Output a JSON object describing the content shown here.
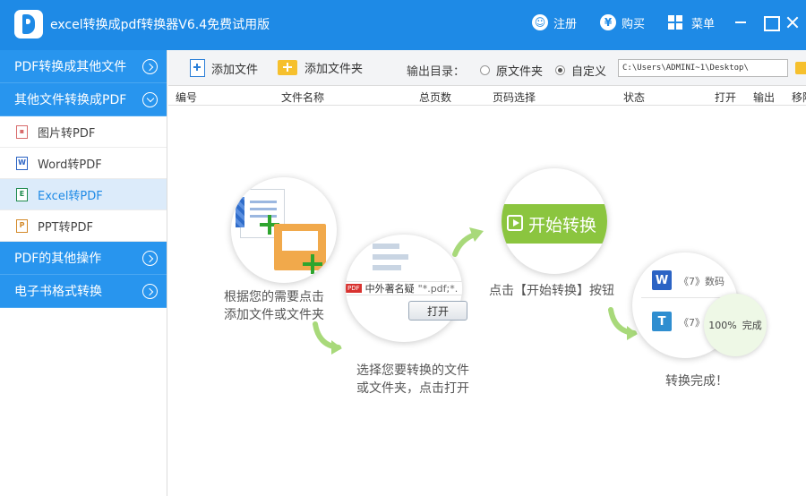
{
  "app": {
    "title": "excel转换成pdf转换器V6.4免费试用版",
    "register_label": "注册",
    "buy_label": "购买",
    "menu_label": "菜单",
    "register_icon_glyph": "☺",
    "buy_icon_glyph": "¥",
    "accent_color": "#1e8ae6"
  },
  "sidebar": {
    "categories": [
      {
        "label": "PDF转换成其他文件"
      },
      {
        "label": "其他文件转换成PDF"
      },
      {
        "label": "PDF的其他操作"
      },
      {
        "label": "电子书格式转换"
      }
    ],
    "subitems": [
      {
        "label": "图片转PDF",
        "icon": "image-file-icon"
      },
      {
        "label": "Word转PDF",
        "icon": "word-file-icon"
      },
      {
        "label": "Excel转PDF",
        "icon": "excel-file-icon"
      },
      {
        "label": "PPT转PDF",
        "icon": "ppt-file-icon"
      }
    ],
    "active_subitem": "Excel转PDF"
  },
  "toolbar": {
    "add_file_label": "添加文件",
    "add_folder_label": "添加文件夹",
    "output_dir_label": "输出目录：",
    "option_original_label": "原文件夹",
    "option_custom_label": "自定义",
    "selected_option": "自定义",
    "path_value": "C:\\Users\\ADMINI~1\\Desktop\\"
  },
  "table": {
    "columns": [
      "编号",
      "文件名称",
      "总页数",
      "页码选择",
      "状态",
      "打开",
      "输出",
      "移除"
    ]
  },
  "guide": {
    "step1_line1": "根据您的需要点击",
    "step1_line2": "添加文件或文件夹",
    "step2_line1": "选择您要转换的文件",
    "step2_line2": "或文件夹，点击打开",
    "step2_filename": "中外著名疑",
    "step2_ext": "\"*.pdf;*.",
    "step2_open_button": "打开",
    "pdf_tag": "PDF",
    "step3_label": "点击【开始转换】按钮",
    "step3_button": "开始转换",
    "step4_label": "转换完成！",
    "step4_row1_text": "《7》数码",
    "step4_row2_text": "《7》",
    "step4_progress": "100%",
    "step4_done": "完成",
    "word_icon_letter": "W",
    "text_icon_letter": "T"
  }
}
